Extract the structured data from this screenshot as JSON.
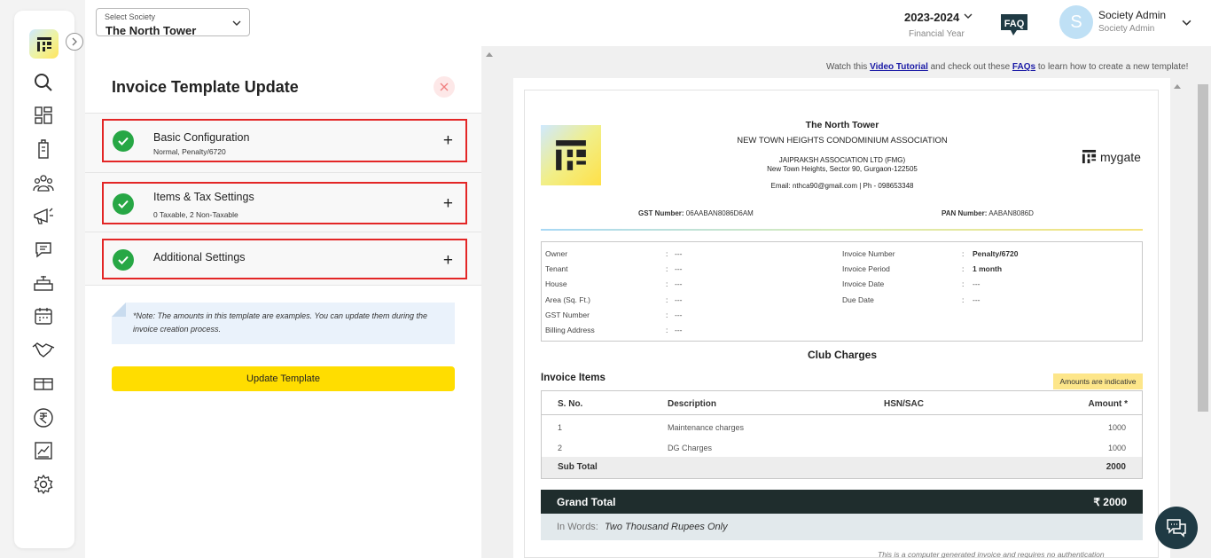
{
  "topbar": {
    "society_label": "Select Society",
    "society_value": "The North Tower",
    "financial_year": "2023-2024",
    "financial_year_label": "Financial Year",
    "faq_label": "FAQ",
    "avatar_initial": "S",
    "user_name": "Society Admin",
    "user_role": "Society Admin"
  },
  "sidebar": {
    "icons": [
      "search-icon",
      "dashboard-icon",
      "building-icon",
      "residents-icon",
      "megaphone-icon",
      "chat-icon",
      "amenity-icon",
      "calendar-icon",
      "handshake-icon",
      "gift-icon",
      "rupee-icon",
      "chart-icon",
      "settings-icon"
    ]
  },
  "panel": {
    "title": "Invoice Template Update",
    "sections": [
      {
        "title": "Basic Configuration",
        "subtitle": "Normal, Penalty/6720"
      },
      {
        "title": "Items & Tax Settings",
        "subtitle": "0 Taxable, 2 Non-Taxable"
      },
      {
        "title": "Additional Settings",
        "subtitle": ""
      }
    ],
    "note": "*Note: The amounts in this template are examples. You can update them during the invoice creation process.",
    "update_button": "Update Template"
  },
  "preview": {
    "watch_prefix": "Watch this ",
    "video_link": "Video Tutorial",
    "watch_middle": " and check out these ",
    "faqs_link": "FAQs",
    "watch_suffix": " to learn how to create a new template!"
  },
  "invoice": {
    "brand": "mygate",
    "society_name": "The North Tower",
    "association": "NEW TOWN HEIGHTS CONDOMINIUM ASSOCIATION",
    "company": "JAIPRAKSH ASSOCIATION LTD (FMG)",
    "address": "New Town Heights, Sector 90, Gurgaon-122505",
    "contact": "Email: nthca90@gmail.com | Ph - 098653348",
    "gst_label": "GST Number:",
    "gst_value": "06AABAN8086D6AM",
    "pan_label": "PAN Number:",
    "pan_value": "AABAN8086D",
    "left_details": [
      {
        "label": "Owner",
        "value": "---"
      },
      {
        "label": "Tenant",
        "value": "---"
      },
      {
        "label": "House",
        "value": "---"
      },
      {
        "label": "Area (Sq. Ft.)",
        "value": "---"
      },
      {
        "label": "GST Number",
        "value": "---"
      },
      {
        "label": "Billing Address",
        "value": "---"
      }
    ],
    "right_details": [
      {
        "label": "Invoice Number",
        "value": "Penalty/6720"
      },
      {
        "label": "Invoice Period",
        "value": "1 month"
      },
      {
        "label": "Invoice Date",
        "value": "---"
      },
      {
        "label": "Due Date",
        "value": "---"
      }
    ],
    "colon": ":",
    "charges_title": "Club Charges",
    "items_label": "Invoice Items",
    "indicative": "Amounts are indicative",
    "table_headers": {
      "sno": "S. No.",
      "desc": "Description",
      "hsn": "HSN/SAC",
      "amount": "Amount *"
    },
    "items": [
      {
        "sno": "1",
        "desc": "Maintenance charges",
        "amount": "1000"
      },
      {
        "sno": "2",
        "desc": "DG Charges",
        "amount": "1000"
      }
    ],
    "subtotal_label": "Sub Total",
    "subtotal_value": "2000",
    "grand_total_label": "Grand Total",
    "grand_total_value": "₹ 2000",
    "in_words_label": "In Words:",
    "in_words_value": "Two Thousand Rupees Only",
    "footer_note": "This is a computer generated invoice and requires no authentication"
  }
}
